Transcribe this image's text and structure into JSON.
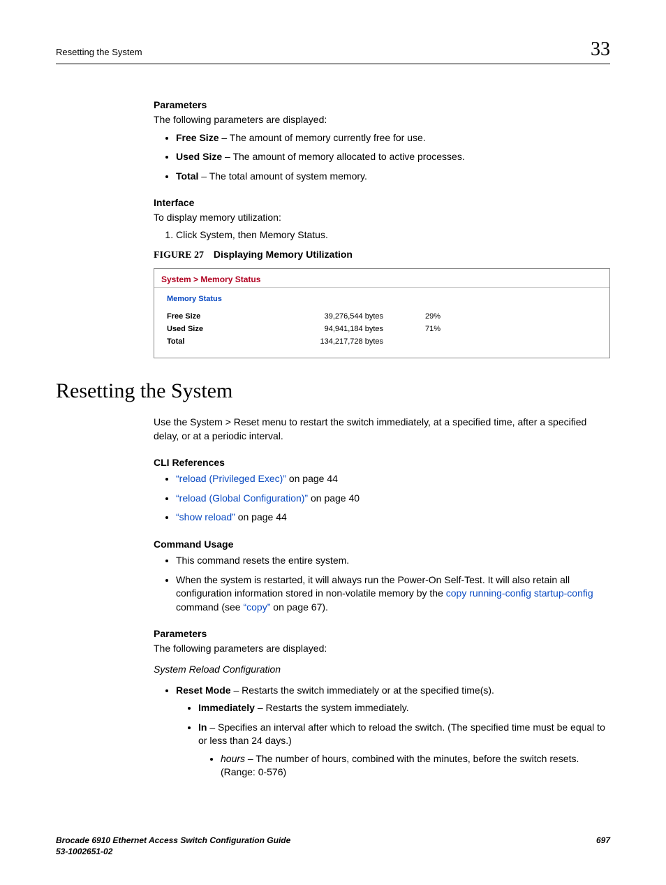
{
  "header": {
    "section_title": "Resetting the System",
    "chapter_number": "33"
  },
  "parameters1": {
    "heading": "Parameters",
    "intro": "The following parameters are displayed:",
    "items": [
      {
        "term": "Free Size",
        "desc": " – The amount of memory currently free for use."
      },
      {
        "term": "Used Size",
        "desc": " – The amount of memory allocated to active processes."
      },
      {
        "term": "Total",
        "desc": " – The total amount of system memory."
      }
    ]
  },
  "interface": {
    "heading": "Interface",
    "intro": "To display memory utilization:",
    "step1": "Click System, then Memory Status."
  },
  "figure": {
    "label": "FIGURE 27",
    "title": "Displaying Memory Utilization",
    "breadcrumb": "System > Memory Status",
    "panel_title": "Memory Status",
    "rows": [
      {
        "label": "Free Size",
        "value": "39,276,544 bytes",
        "pct": "29%"
      },
      {
        "label": "Used Size",
        "value": "94,941,184 bytes",
        "pct": "71%"
      },
      {
        "label": "Total",
        "value": "134,217,728 bytes",
        "pct": ""
      }
    ]
  },
  "main_heading": "Resetting the System",
  "main_intro": "Use the System > Reset menu to restart the switch immediately, at a specified time, after a specified delay, or at a periodic interval.",
  "cli": {
    "heading": "CLI References",
    "items": [
      {
        "link": "“reload (Privileged Exec)”",
        "suffix": " on page 44"
      },
      {
        "link": "“reload (Global Configuration)”",
        "suffix": " on page 40"
      },
      {
        "link": "“show reload”",
        "suffix": " on page 44"
      }
    ]
  },
  "usage": {
    "heading": "Command Usage",
    "item1": "This command resets the entire system.",
    "item2_pre": "When the system is restarted, it will always run the Power-On Self-Test. It will also retain all configuration information stored in non-volatile memory by the ",
    "item2_link1": "copy running-config startup-config",
    "item2_mid": " command (see ",
    "item2_link2": "“copy”",
    "item2_post": " on page 67)."
  },
  "parameters2": {
    "heading": "Parameters",
    "intro": "The following parameters are displayed:",
    "subheading": "System Reload Configuration",
    "reset_mode": {
      "term": "Reset Mode",
      "desc": " – Restarts the switch immediately or at the specified time(s)."
    },
    "immediately": {
      "term": "Immediately",
      "desc": " – Restarts the system immediately."
    },
    "in": {
      "term": "In",
      "desc": " – Specifies an interval after which to reload the switch. (The specified time must be equal to or less than 24 days.)"
    },
    "hours": {
      "term": "hours",
      "desc": " – The number of hours, combined with the minutes, before the switch resets. (Range: 0-576)"
    }
  },
  "footer": {
    "title": "Brocade 6910 Ethernet Access Switch Configuration Guide",
    "docnum": "53-1002651-02",
    "page": "697"
  }
}
